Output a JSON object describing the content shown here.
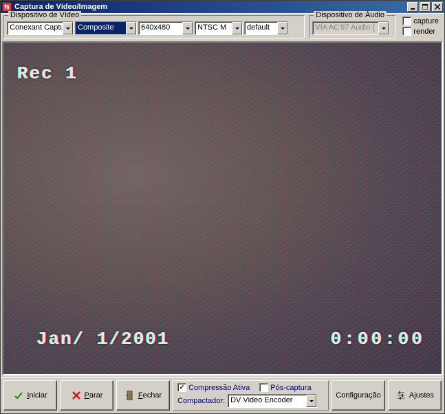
{
  "title": "Captura de Vídeo/Imagem",
  "video_group": {
    "legend": "Dispositivo de Vídeo",
    "device": "Conexant Captur",
    "input": "Composite",
    "resolution": "640x480",
    "standard": "NTSC M",
    "mode": "default"
  },
  "audio_group": {
    "legend": "Dispositivo de Áudio",
    "device": "VIA AC'97 Audio (",
    "capture_label": "capture",
    "render_label": "render"
  },
  "osd": {
    "rec": "Rec 1",
    "date": "Jan/ 1/2001",
    "time": "0:00:00"
  },
  "bottom": {
    "iniciar": "Iniciar",
    "parar": "Parar",
    "fechar": "Fechar",
    "compressao_ativa": "Compressão Ativa",
    "pos_captura": "Pós-captura",
    "compactador_label": "Compactador:",
    "compactador_value": "DV Video Encoder",
    "configuracao": "Configuração",
    "ajustes": "Ajustes"
  }
}
